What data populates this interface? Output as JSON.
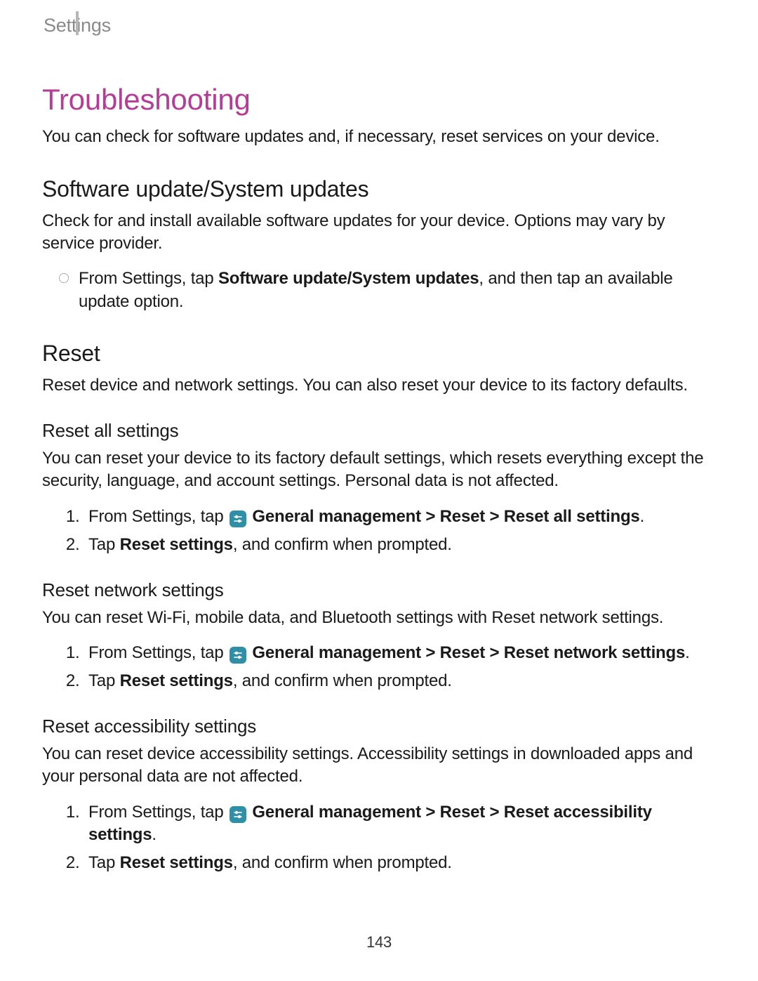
{
  "header": {
    "label": "Settings"
  },
  "title": "Troubleshooting",
  "intro": "You can check for software updates and, if necessary, reset services on your device.",
  "software_update": {
    "heading": "Software update/System updates",
    "body": "Check for and install available software updates for your device. Options may vary by service provider.",
    "bullet_prefix": "From Settings, tap ",
    "bullet_bold": "Software update/System updates",
    "bullet_suffix": ", and then tap an available update option."
  },
  "reset": {
    "heading": "Reset",
    "body": "Reset device and network settings. You can also reset your device to its factory defaults."
  },
  "reset_all": {
    "heading": "Reset all settings",
    "body": "You can reset your device to its factory default settings, which resets everything except the security, language, and account settings. Personal data is not affected.",
    "step1_prefix": "From Settings, tap ",
    "step1_bold": " General management > Reset > Reset all settings",
    "step1_suffix": ".",
    "step2_prefix": "Tap ",
    "step2_bold": "Reset settings",
    "step2_suffix": ", and confirm when prompted."
  },
  "reset_network": {
    "heading": "Reset network settings",
    "body": "You can reset Wi-Fi, mobile data, and Bluetooth settings with Reset network settings.",
    "step1_prefix": "From Settings, tap ",
    "step1_bold": " General management > Reset > Reset network settings",
    "step1_suffix": ".",
    "step2_prefix": "Tap ",
    "step2_bold": "Reset settings",
    "step2_suffix": ", and confirm when prompted."
  },
  "reset_accessibility": {
    "heading": "Reset accessibility settings",
    "body": "You can reset device accessibility settings. Accessibility settings in downloaded apps and your personal data are not affected.",
    "step1_prefix": "From Settings, tap ",
    "step1_bold": " General management > Reset > Reset accessibility settings",
    "step1_suffix": ".",
    "step2_prefix": "Tap ",
    "step2_bold": "Reset settings",
    "step2_suffix": ", and confirm when prompted."
  },
  "page_number": "143"
}
